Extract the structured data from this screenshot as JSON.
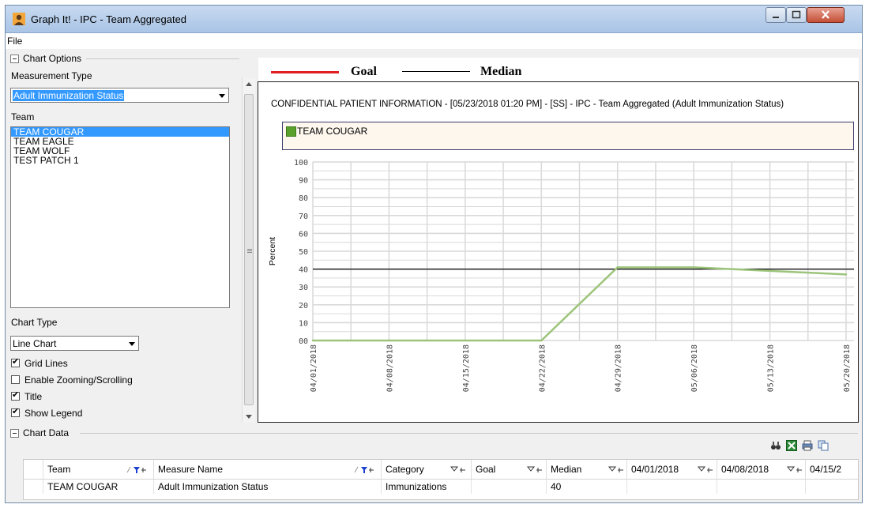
{
  "window": {
    "title": "Graph It! - IPC - Team Aggregated"
  },
  "menu": {
    "file": "File"
  },
  "chart_options": {
    "group_label": "Chart Options",
    "measurement_type_label": "Measurement Type",
    "measurement_type_value": "Adult Immunization Status",
    "team_label": "Team",
    "teams": [
      "TEAM COUGAR",
      "TEAM EAGLE",
      "TEAM WOLF",
      "TEST PATCH 1"
    ],
    "selected_team": "TEAM COUGAR",
    "chart_type_label": "Chart Type",
    "chart_type_value": "Line Chart",
    "checkboxes": [
      {
        "label": "Grid Lines",
        "checked": true
      },
      {
        "label": "Enable Zooming/Scrolling",
        "checked": false
      },
      {
        "label": "Title",
        "checked": true
      },
      {
        "label": "Show Legend",
        "checked": true
      }
    ]
  },
  "top_legend": {
    "goal_label": "Goal",
    "goal_color": "#e02020",
    "median_label": "Median",
    "median_color": "#000000"
  },
  "chart": {
    "title": "CONFIDENTIAL PATIENT INFORMATION - [05/23/2018 01:20 PM] - [SS] - IPC - Team Aggregated (Adult Immunization Status)",
    "legend_item": "TEAM COUGAR",
    "series_color": "#9cc47a"
  },
  "chart_data": {
    "type": "line",
    "title": "CONFIDENTIAL PATIENT INFORMATION - [05/23/2018 01:20 PM] - [SS] - IPC - Team Aggregated (Adult Immunization Status)",
    "ylabel": "Percent",
    "xlabel": "",
    "ylim": [
      0,
      100
    ],
    "yticks": [
      "00",
      "10",
      "20",
      "30",
      "40",
      "50",
      "60",
      "70",
      "80",
      "90",
      "100"
    ],
    "x": [
      "04/01/2018",
      "04/08/2018",
      "04/15/2018",
      "04/22/2018",
      "04/29/2018",
      "05/06/2018",
      "05/13/2018",
      "05/20/2018"
    ],
    "series": [
      {
        "name": "TEAM COUGAR",
        "values": [
          0,
          0,
          0,
          0,
          41,
          41,
          39,
          37
        ]
      }
    ],
    "median": 40,
    "grid": true,
    "legend": "top"
  },
  "chart_data_section": {
    "group_label": "Chart Data",
    "columns": [
      "Team",
      "Measure Name",
      "Category",
      "Goal",
      "Median",
      "04/01/2018",
      "04/08/2018",
      "04/15/2"
    ],
    "rows": [
      [
        "TEAM COUGAR",
        "Adult Immunization Status",
        "Immunizations",
        "",
        "40",
        "",
        "",
        ""
      ]
    ]
  }
}
